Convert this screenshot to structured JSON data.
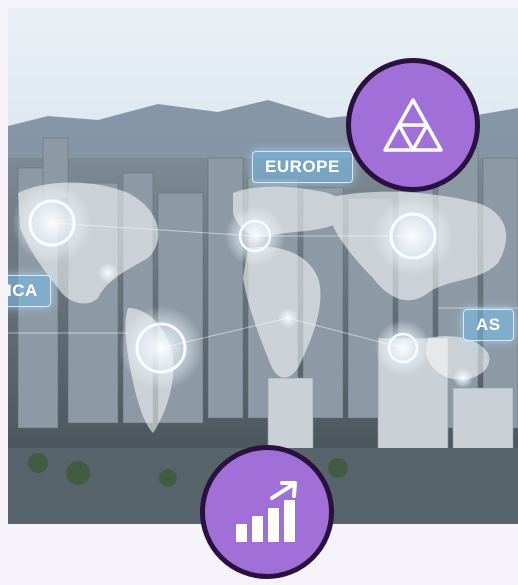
{
  "photo": {
    "description_icon": "world-map-city-icon",
    "labels": {
      "europe": "EUROPE",
      "america": "ICA",
      "asia": "AS"
    }
  },
  "badges": [
    {
      "icon": "triangle-network-icon",
      "color": "#a070d8",
      "border": "#2a1140"
    },
    {
      "icon": "growth-chart-icon",
      "color": "#a070d8",
      "border": "#2a1140"
    }
  ],
  "colors": {
    "background": "#f7f3fb",
    "accent": "#a070d8",
    "outline": "#2a1140"
  }
}
